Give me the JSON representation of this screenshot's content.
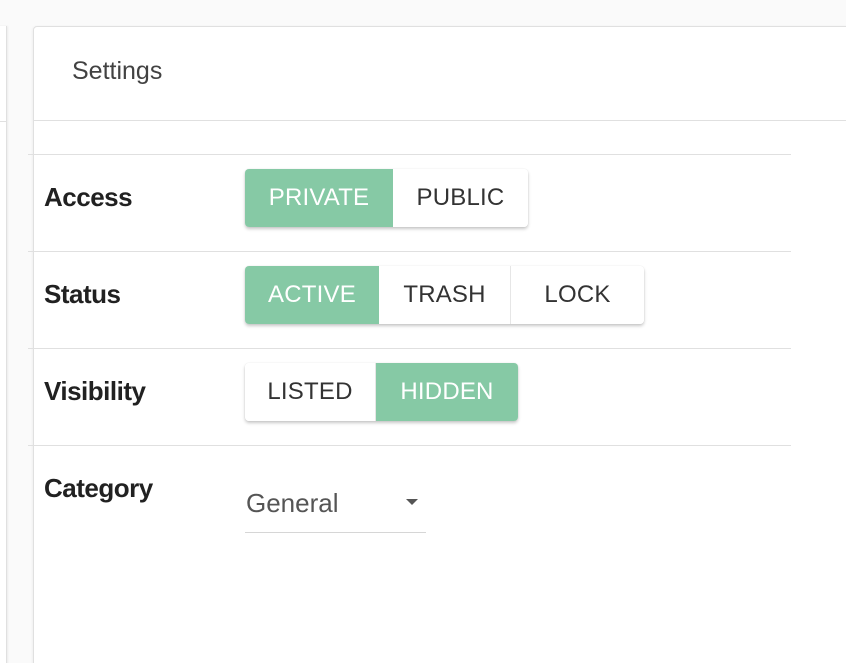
{
  "settings_card": {
    "title": "Settings"
  },
  "rows": {
    "access": {
      "label": "Access",
      "options": [
        "PRIVATE",
        "PUBLIC"
      ],
      "selected": "PRIVATE"
    },
    "status": {
      "label": "Status",
      "options": [
        "ACTIVE",
        "TRASH",
        "LOCK"
      ],
      "selected": "ACTIVE"
    },
    "visibility": {
      "label": "Visibility",
      "options": [
        "LISTED",
        "HIDDEN"
      ],
      "selected": "HIDDEN"
    },
    "category": {
      "label": "Category",
      "value": "General",
      "icon": "caret-down-icon"
    }
  },
  "colors": {
    "accent": "#86c9a5",
    "divider": "#e0e0e0"
  }
}
